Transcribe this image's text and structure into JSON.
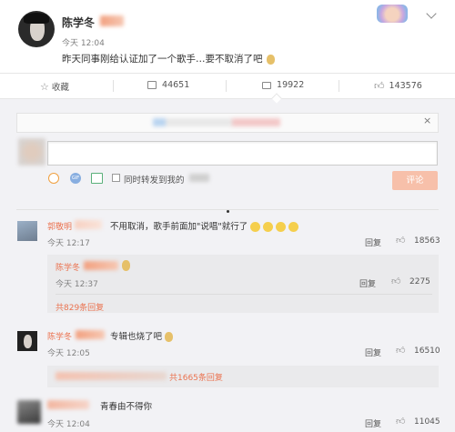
{
  "post": {
    "author": "陈学冬",
    "time": "今天 12:04",
    "text": "昨天同事刚给认证加了一个歌手…要不取消了吧"
  },
  "actions": {
    "favorite": "收藏",
    "repost_count": "44651",
    "comment_count": "19922",
    "like_count": "143576"
  },
  "composer": {
    "sync_label": "同时转发到我的",
    "submit": "评论"
  },
  "comments": [
    {
      "author": "郭敬明",
      "text": "不用取消，歌手前面加\"说唱\"就行了",
      "time": "今天 12:17",
      "reply": "回复",
      "likes": "18563",
      "sub": {
        "author": "陈学冬",
        "time": "今天 12:37",
        "reply": "回复",
        "likes": "2275",
        "more": "共829条回复"
      }
    },
    {
      "author": "陈学冬",
      "text": "专辑也烧了吧",
      "time": "今天 12:05",
      "reply": "回复",
      "likes": "16510",
      "more": "共1665条回复"
    },
    {
      "author": "",
      "text": "青春由不得你",
      "time": "今天 12:04",
      "reply": "回复",
      "likes": "11045"
    }
  ],
  "colors": {
    "accent": "#eb7350",
    "submit_bg": "#f7c0aa",
    "link": "#eb7350"
  }
}
